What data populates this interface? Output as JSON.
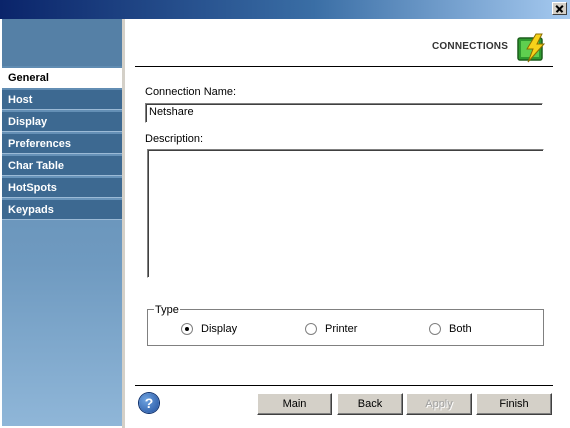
{
  "header": {
    "title": "CONNECTIONS",
    "icon": "lightning-connection-icon"
  },
  "sidebar": {
    "items": [
      {
        "label": "General",
        "active": true
      },
      {
        "label": "Host"
      },
      {
        "label": "Display"
      },
      {
        "label": "Preferences"
      },
      {
        "label": "Char Table"
      },
      {
        "label": "HotSpots"
      },
      {
        "label": "Keypads"
      }
    ]
  },
  "form": {
    "connection_name_label": "Connection Name:",
    "connection_name_value": "Netshare",
    "description_label": "Description:",
    "description_value": "",
    "type_label": "Type",
    "type_options": [
      {
        "label": "Display",
        "checked": true
      },
      {
        "label": "Printer",
        "checked": false
      },
      {
        "label": "Both",
        "checked": false
      }
    ]
  },
  "footer": {
    "help_icon": "help-question-icon",
    "buttons": [
      {
        "label": "Main",
        "enabled": true
      },
      {
        "label": "Back",
        "enabled": true
      },
      {
        "label": "Apply",
        "enabled": false
      },
      {
        "label": "Finish",
        "enabled": true
      }
    ]
  },
  "colors": {
    "title_gradient_start": "#0a246a",
    "sidebar": "#3d6991",
    "panel": "#ffffff"
  }
}
